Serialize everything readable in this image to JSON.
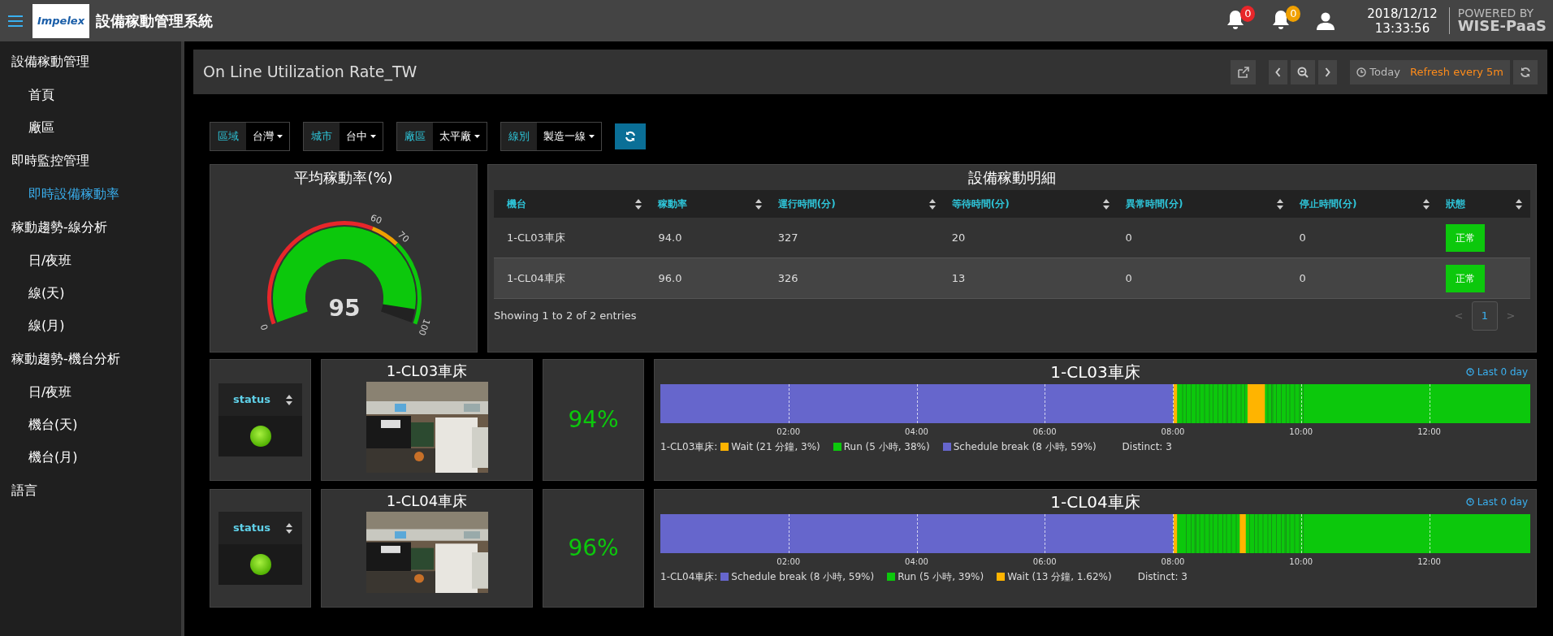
{
  "header": {
    "logo": "Impelex",
    "title": "設備稼動管理系統",
    "notifications": [
      {
        "count": "0",
        "color": "#e8262a"
      },
      {
        "count": "0",
        "color": "#f0a000"
      }
    ],
    "date": "2018/12/12",
    "time": "13:33:56",
    "powered_by": "POWERED BY",
    "brand": "WISE-PaaS"
  },
  "sidebar": [
    {
      "label": "設備稼動管理",
      "children": [
        {
          "label": "首頁",
          "selected": false
        },
        {
          "label": "廠區",
          "selected": false
        }
      ]
    },
    {
      "label": "即時監控管理",
      "children": [
        {
          "label": "即時設備稼動率",
          "selected": true
        }
      ]
    },
    {
      "label": "稼動趨勢-線分析",
      "children": [
        {
          "label": "日/夜班",
          "selected": false
        },
        {
          "label": "線(天)",
          "selected": false
        },
        {
          "label": "線(月)",
          "selected": false
        }
      ]
    },
    {
      "label": "稼動趨勢-機台分析",
      "children": [
        {
          "label": "日/夜班",
          "selected": false
        },
        {
          "label": "機台(天)",
          "selected": false
        },
        {
          "label": "機台(月)",
          "selected": false
        }
      ]
    },
    {
      "label": "語言"
    }
  ],
  "dashboard": {
    "title": "On Line Utilization Rate_TW",
    "time_range": "Today",
    "refresh": "Refresh every 5m"
  },
  "filters": [
    {
      "label": "區域",
      "value": "台灣"
    },
    {
      "label": "城市",
      "value": "台中"
    },
    {
      "label": "廠區",
      "value": "太平廠"
    },
    {
      "label": "線別",
      "value": "製造一線"
    }
  ],
  "gauge": {
    "title": "平均稼動率(%)",
    "level": 0.95,
    "value": "95",
    "ticks": [
      "0",
      "60",
      "70",
      "100"
    ]
  },
  "table": {
    "title": "設備稼動明細",
    "columns": [
      "機台",
      "稼動率",
      "運行時間(分)",
      "等待時間(分)",
      "異常時間(分)",
      "停止時間(分)",
      "狀態"
    ],
    "rows": [
      {
        "cells": [
          "1-CL03車床",
          "94.0",
          "327",
          "20",
          "0",
          "0"
        ],
        "status": "正常"
      },
      {
        "cells": [
          "1-CL04車床",
          "96.0",
          "326",
          "13",
          "0",
          "0"
        ],
        "status": "正常"
      }
    ],
    "info": "Showing 1 to 2 of 2 entries",
    "pagination": [
      {
        "label": "<",
        "selected": false
      },
      {
        "label": "1",
        "selected": true
      },
      {
        "label": ">",
        "selected": false
      }
    ]
  },
  "machines": [
    {
      "status_header": "status",
      "lamp_on": true,
      "name": "1-CL03車床",
      "rate": "94%",
      "timeline": {
        "title": "1-CL03車床",
        "range": "Last 0 day",
        "ticks": [
          "02:00",
          "04:00",
          "06:00",
          "08:00",
          "10:00",
          "12:00"
        ],
        "legend_label": "1-CL03車床:",
        "legend": [
          {
            "kind": "wait",
            "label": "Wait (21 分鐘, 3%)",
            "color": "#ffb400"
          },
          {
            "kind": "run",
            "label": "Run (5 小時, 38%)",
            "color": "#0cc80c"
          },
          {
            "kind": "break",
            "label": "Schedule break (8 小時, 59%)",
            "color": "#6666cc"
          }
        ],
        "distinct": "Distinct: 3"
      }
    },
    {
      "status_header": "status",
      "lamp_on": true,
      "name": "1-CL04車床",
      "rate": "96%",
      "timeline": {
        "title": "1-CL04車床",
        "range": "Last 0 day",
        "ticks": [
          "02:00",
          "04:00",
          "06:00",
          "08:00",
          "10:00",
          "12:00"
        ],
        "legend_label": "1-CL04車床:",
        "legend": [
          {
            "kind": "break",
            "label": "Schedule break (8 小時, 59%)",
            "color": "#6666cc"
          },
          {
            "kind": "run",
            "label": "Run (5 小時, 39%)",
            "color": "#0cc80c"
          },
          {
            "kind": "wait",
            "label": "Wait (13 分鐘, 1.62%)",
            "color": "#ffb400"
          }
        ],
        "distinct": "Distinct: 3"
      }
    }
  ]
}
